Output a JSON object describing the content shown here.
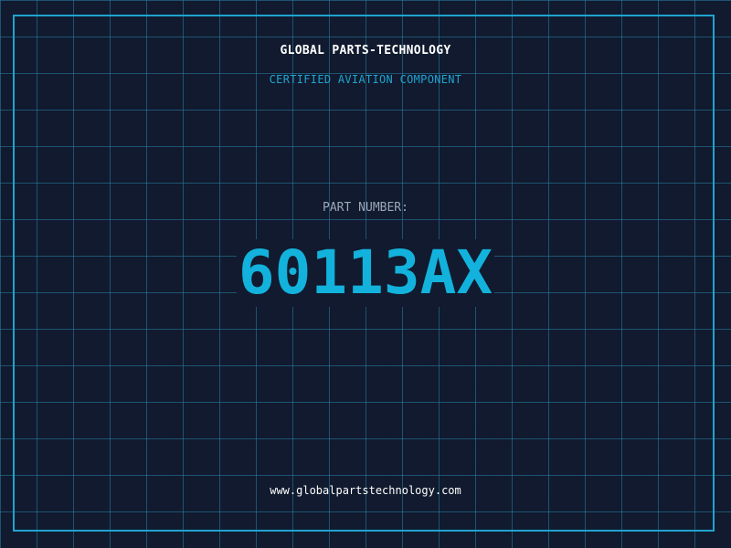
{
  "label": {
    "brand": "GLOBAL PARTS-TECHNOLOGY",
    "subtitle": "CERTIFIED AVIATION COMPONENT",
    "part_label": "PART NUMBER:",
    "part_number": "60113AX",
    "website": "www.globalpartstechnology.com"
  },
  "colors": {
    "background": "#111a2e",
    "grid": "#2882aa",
    "accent": "#1fa3cf",
    "part_number": "#12b2dc",
    "text": "#ffffff",
    "muted": "#9aa8b8"
  }
}
